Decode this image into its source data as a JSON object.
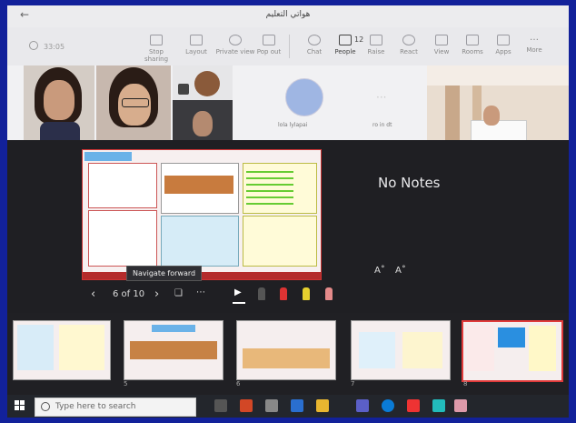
{
  "window": {
    "title": "هواتي التعليم",
    "back_icon": "back-arrow-icon"
  },
  "toolbar": {
    "timer": "33:05",
    "buttons": [
      {
        "label": "Stop sharing",
        "icon": "stop-share-icon"
      },
      {
        "label": "Layout",
        "icon": "layout-icon"
      },
      {
        "label": "Private view",
        "icon": "eye-icon"
      },
      {
        "label": "Pop out",
        "icon": "pop-out-icon"
      },
      {
        "label": "Chat",
        "icon": "chat-icon"
      },
      {
        "label": "People",
        "icon": "people-icon",
        "count": "12"
      },
      {
        "label": "Raise",
        "icon": "hand-icon"
      },
      {
        "label": "React",
        "icon": "smile-icon"
      },
      {
        "label": "View",
        "icon": "grid-icon"
      },
      {
        "label": "Rooms",
        "icon": "rooms-icon"
      },
      {
        "label": "Apps",
        "icon": "apps-icon"
      },
      {
        "label": "More",
        "icon": "more-icon"
      }
    ]
  },
  "gallery": {
    "participants": [
      {
        "name": ""
      },
      {
        "name": ""
      },
      {
        "name": ""
      },
      {
        "name": ""
      },
      {
        "name": "lola lylapai"
      },
      {
        "name": "ro in dt"
      },
      {
        "name": ""
      }
    ]
  },
  "presenter": {
    "notes": "No Notes",
    "slide_counter": "6 of 10",
    "tooltip": "Navigate forward",
    "font_smaller": "A˚",
    "font_larger": "A˚"
  },
  "thumbnails": [
    {
      "number": ""
    },
    {
      "number": "5"
    },
    {
      "number": "6"
    },
    {
      "number": "7"
    },
    {
      "number": "8"
    }
  ],
  "taskbar": {
    "search_placeholder": "Type here to search"
  },
  "colors": {
    "accent": "#e03a3a",
    "frame": "#12219a",
    "tb_bg": "#e9e9ec"
  }
}
